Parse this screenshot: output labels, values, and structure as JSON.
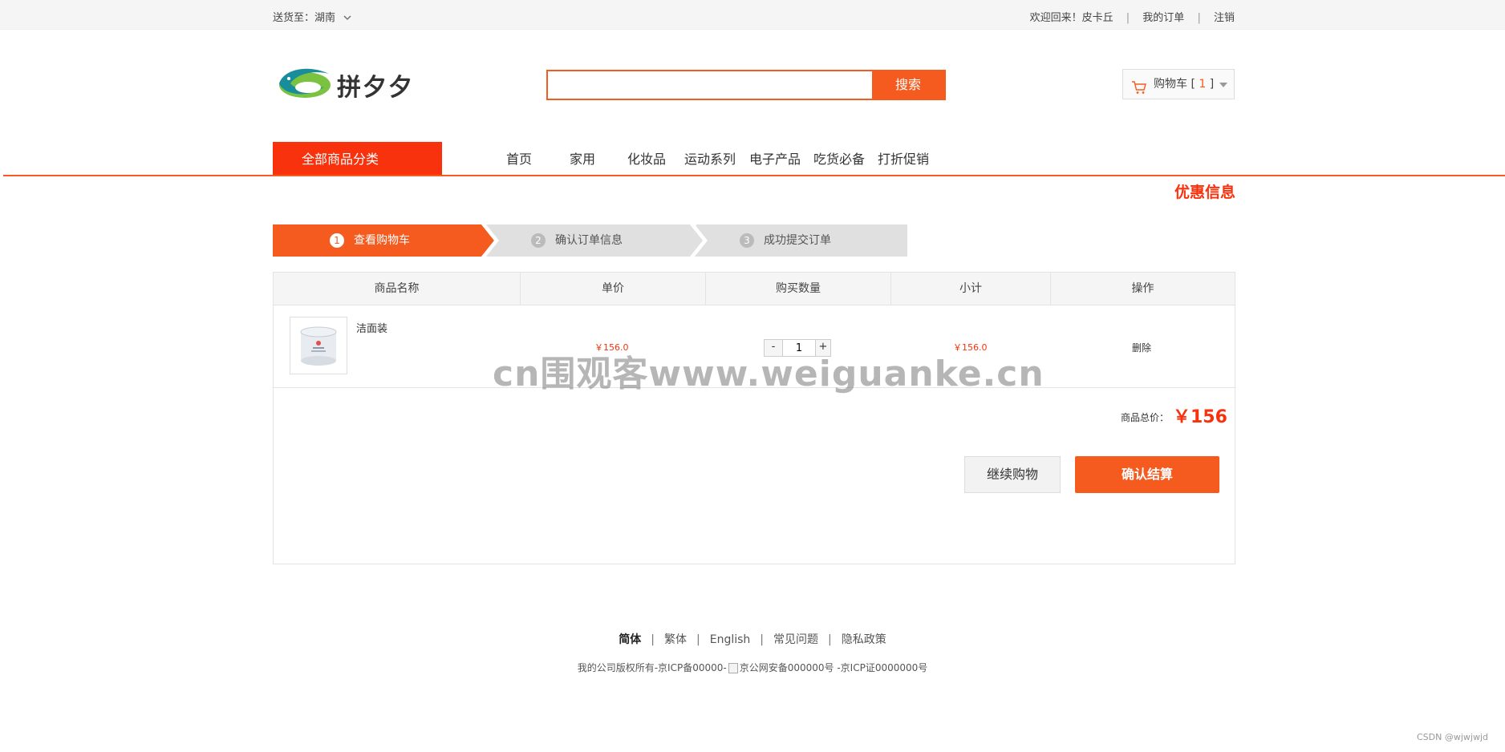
{
  "topbar": {
    "deliver_label": "送货至：湖南",
    "welcome": "欢迎回来！皮卡丘",
    "my_orders": "我的订单",
    "logout": "注销",
    "separator": "|"
  },
  "header": {
    "logo_text": "拼夕夕",
    "search": {
      "value": "",
      "placeholder": "",
      "button": "搜索"
    },
    "cart": {
      "label": "购物车 [ ",
      "count": "1",
      "suffix": " ]"
    }
  },
  "nav": {
    "all_categories": "全部商品分类",
    "items": [
      "首页",
      "家用",
      "化妆品",
      "运动系列",
      "电子产品",
      "吃货必备",
      "打折促销"
    ]
  },
  "promo": "优惠信息",
  "steps": [
    {
      "num": "1",
      "label": "查看购物车",
      "active": true
    },
    {
      "num": "2",
      "label": "确认订单信息",
      "active": false
    },
    {
      "num": "3",
      "label": "成功提交订单",
      "active": false
    }
  ],
  "table": {
    "headers": [
      "商品名称",
      "单价",
      "购买数量",
      "小计",
      "操作"
    ],
    "row": {
      "name": "洁面装",
      "price": "￥156.0",
      "quantity": "1",
      "minus": "-",
      "plus": "+",
      "subtotal": "￥156.0",
      "action": "删除"
    }
  },
  "summary": {
    "total_label": "商品总价：",
    "total_value": "￥156",
    "continue_button": "继续购物",
    "checkout_button": "确认结算"
  },
  "watermark": "cn围观客www.weiguanke.cn",
  "footer": {
    "links": [
      "简体",
      "繁体",
      "English",
      "常见问题",
      "隐私政策"
    ],
    "separator": "|",
    "copyright_a": "我的公司版权所有-京ICP备00000-",
    "copyright_b": "京公网安备000000号",
    "copyright_c": " -京ICP证0000000号"
  },
  "credit": "CSDN @wjwjwjd",
  "colors": {
    "accent": "#f55a1e",
    "red": "#f8320c"
  }
}
